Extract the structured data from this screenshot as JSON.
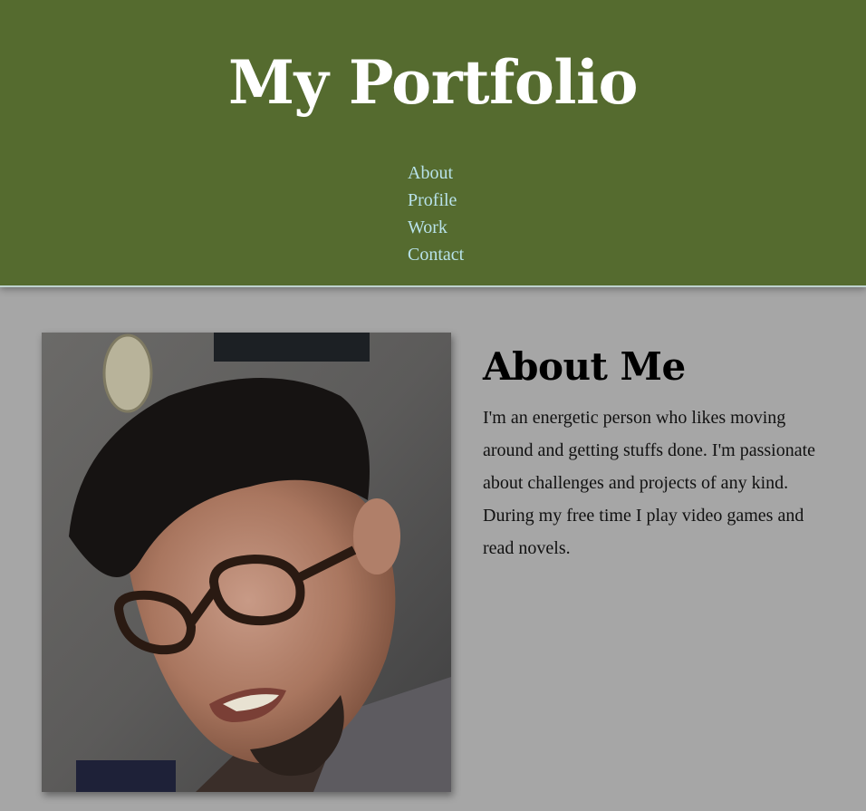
{
  "header": {
    "title": "My Portfolio",
    "nav": [
      {
        "label": "About"
      },
      {
        "label": "Profile"
      },
      {
        "label": "Work"
      },
      {
        "label": "Contact"
      }
    ]
  },
  "about": {
    "heading": "About Me",
    "text": "I'm an energetic person who likes moving around and getting stuffs done. I'm passionate about challenges and projects of any kind. During my free time I play video games and read novels.",
    "photo_alt": "Profile photo"
  },
  "colors": {
    "header_bg": "#556b2f",
    "nav_link": "#b8e2ea",
    "page_bg": "#a6a6a6",
    "title": "#ffffff"
  }
}
